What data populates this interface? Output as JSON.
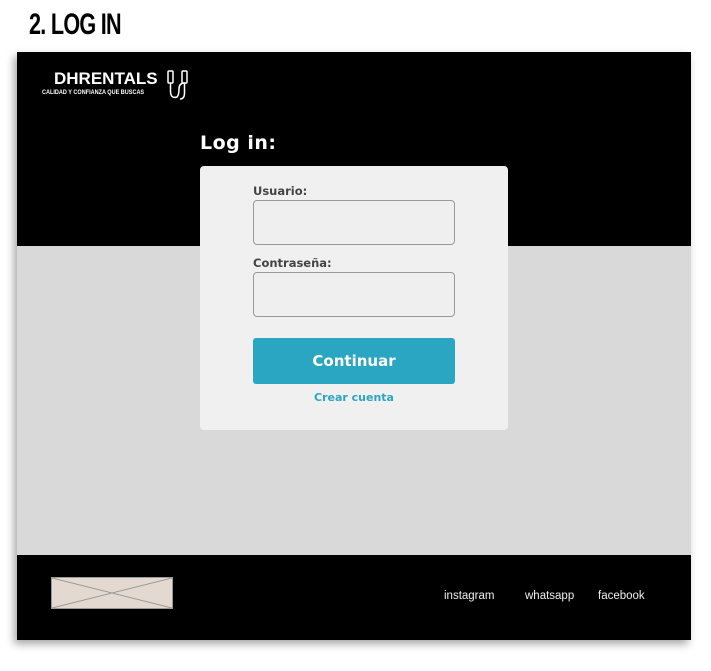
{
  "page_title": "2. LOG IN",
  "header": {
    "brand": "DHRENTALS",
    "tagline": "CALIDAD Y CONFIANZA QUE BUSCAS",
    "logo_icon": "audio-cable-icon"
  },
  "login": {
    "title": "Log in:",
    "user_label": "Usuario:",
    "user_value": "",
    "password_label": "Contraseña:",
    "password_value": "",
    "submit": "Continuar",
    "create_account": "Crear cuenta"
  },
  "footer": {
    "links": [
      "instagram",
      "whatsapp",
      "facebook"
    ]
  },
  "colors": {
    "accent": "#2aa6c2",
    "header": "#000000",
    "body": "#d9d9d9",
    "card": "#f0f0f0"
  }
}
